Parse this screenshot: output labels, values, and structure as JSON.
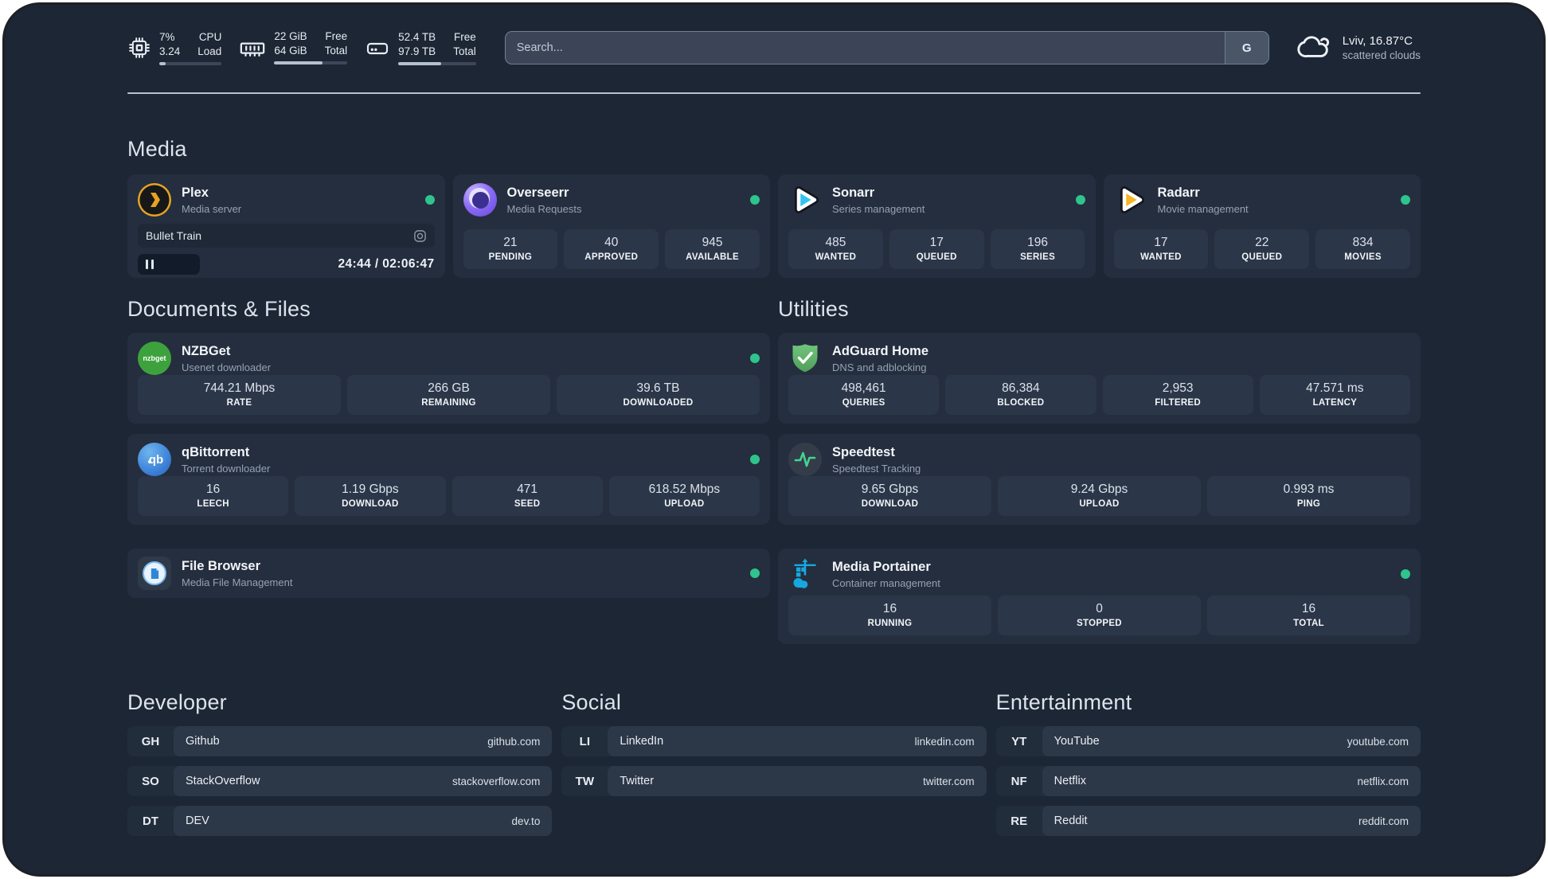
{
  "header": {
    "cpu": {
      "value_top": "7%",
      "value_bottom": "3.24",
      "label_top": "CPU",
      "label_bottom": "Load",
      "bar_fill": "10%"
    },
    "memory": {
      "value_top": "22 GiB",
      "value_bottom": "64 GiB",
      "label_top": "Free",
      "label_bottom": "Total",
      "bar_fill": "66%"
    },
    "disk": {
      "value_top": "52.4 TB",
      "value_bottom": "97.9 TB",
      "label_top": "Free",
      "label_bottom": "Total",
      "bar_fill": "55%"
    },
    "search": {
      "placeholder": "Search...",
      "button_label": "G"
    },
    "weather": {
      "location": "Lviv, 16.87°C",
      "condition": "scattered clouds"
    }
  },
  "sections": {
    "media": {
      "title": "Media"
    },
    "documents": {
      "title": "Documents & Files"
    },
    "utilities": {
      "title": "Utilities"
    }
  },
  "services": {
    "plex": {
      "name": "Plex",
      "desc": "Media server",
      "now_playing": "Bullet Train",
      "progress": "20%",
      "time": "24:44 / 02:06:47"
    },
    "overseerr": {
      "name": "Overseerr",
      "desc": "Media Requests",
      "stats": [
        {
          "value": "21",
          "label": "PENDING"
        },
        {
          "value": "40",
          "label": "APPROVED"
        },
        {
          "value": "945",
          "label": "AVAILABLE"
        }
      ]
    },
    "sonarr": {
      "name": "Sonarr",
      "desc": "Series management",
      "stats": [
        {
          "value": "485",
          "label": "WANTED"
        },
        {
          "value": "17",
          "label": "QUEUED"
        },
        {
          "value": "196",
          "label": "SERIES"
        }
      ]
    },
    "radarr": {
      "name": "Radarr",
      "desc": "Movie management",
      "stats": [
        {
          "value": "17",
          "label": "WANTED"
        },
        {
          "value": "22",
          "label": "QUEUED"
        },
        {
          "value": "834",
          "label": "MOVIES"
        }
      ]
    },
    "nzbget": {
      "name": "NZBGet",
      "desc": "Usenet downloader",
      "stats": [
        {
          "value": "744.21 Mbps",
          "label": "RATE"
        },
        {
          "value": "266 GB",
          "label": "REMAINING"
        },
        {
          "value": "39.6 TB",
          "label": "DOWNLOADED"
        }
      ]
    },
    "qbittorrent": {
      "name": "qBittorrent",
      "desc": "Torrent downloader",
      "stats": [
        {
          "value": "16",
          "label": "LEECH"
        },
        {
          "value": "1.19 Gbps",
          "label": "DOWNLOAD"
        },
        {
          "value": "471",
          "label": "SEED"
        },
        {
          "value": "618.52 Mbps",
          "label": "UPLOAD"
        }
      ]
    },
    "filebrowser": {
      "name": "File Browser",
      "desc": "Media File Management"
    },
    "adguard": {
      "name": "AdGuard Home",
      "desc": "DNS and adblocking",
      "stats": [
        {
          "value": "498,461",
          "label": "QUERIES"
        },
        {
          "value": "86,384",
          "label": "BLOCKED"
        },
        {
          "value": "2,953",
          "label": "FILTERED"
        },
        {
          "value": "47.571 ms",
          "label": "LATENCY"
        }
      ]
    },
    "speedtest": {
      "name": "Speedtest",
      "desc": "Speedtest Tracking",
      "stats": [
        {
          "value": "9.65 Gbps",
          "label": "DOWNLOAD"
        },
        {
          "value": "9.24 Gbps",
          "label": "UPLOAD"
        },
        {
          "value": "0.993 ms",
          "label": "PING"
        }
      ]
    },
    "portainer": {
      "name": "Media Portainer",
      "desc": "Container management",
      "stats": [
        {
          "value": "16",
          "label": "RUNNING"
        },
        {
          "value": "0",
          "label": "STOPPED"
        },
        {
          "value": "16",
          "label": "TOTAL"
        }
      ]
    }
  },
  "bookmarks": {
    "developer": {
      "title": "Developer",
      "items": [
        {
          "abbr": "GH",
          "name": "Github",
          "url": "github.com"
        },
        {
          "abbr": "SO",
          "name": "StackOverflow",
          "url": "stackoverflow.com"
        },
        {
          "abbr": "DT",
          "name": "DEV",
          "url": "dev.to"
        }
      ]
    },
    "social": {
      "title": "Social",
      "items": [
        {
          "abbr": "LI",
          "name": "LinkedIn",
          "url": "linkedin.com"
        },
        {
          "abbr": "TW",
          "name": "Twitter",
          "url": "twitter.com"
        }
      ]
    },
    "entertainment": {
      "title": "Entertainment",
      "items": [
        {
          "abbr": "YT",
          "name": "YouTube",
          "url": "youtube.com"
        },
        {
          "abbr": "NF",
          "name": "Netflix",
          "url": "netflix.com"
        },
        {
          "abbr": "RE",
          "name": "Reddit",
          "url": "reddit.com"
        }
      ]
    }
  },
  "colors": {
    "status_online": "#2fc48d"
  }
}
